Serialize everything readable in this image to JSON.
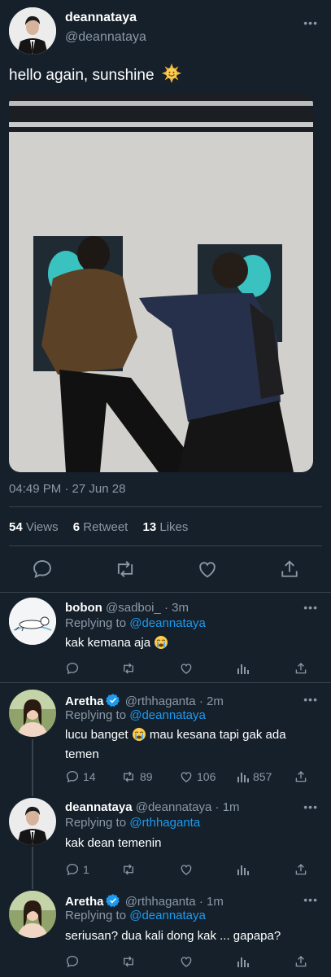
{
  "main": {
    "name": "deannataya",
    "handle": "@deannataya",
    "text": "hello again, sunshine",
    "timestamp": "04:49 PM · 27 Jun 28",
    "stats": {
      "views_count": "54",
      "views_label": "Views",
      "retweets_count": "6",
      "retweets_label": "Retweet",
      "likes_count": "13",
      "likes_label": "Likes"
    },
    "more": "•••"
  },
  "replies": [
    {
      "name": "bobon",
      "handle": "@sadboi_",
      "time": "· 3m",
      "replying_prefix": "Replying to",
      "replying_to": "@deannataya",
      "text": "kak kemana aja",
      "verified": false,
      "counts": {
        "reply": "",
        "retweet": "",
        "like": "",
        "views": ""
      }
    },
    {
      "name": "Aretha",
      "handle": "@rthhaganta",
      "time": "· 2m",
      "replying_prefix": "Replying to",
      "replying_to": "@deannataya",
      "text_a": "lucu banget",
      "text_b": "mau kesana tapi gak ada",
      "text_c": "temen",
      "verified": true,
      "counts": {
        "reply": "14",
        "retweet": "89",
        "like": "106",
        "views": "857"
      }
    },
    {
      "name": "deannataya",
      "handle": "@deannataya",
      "time": "· 1m",
      "replying_prefix": "Replying to",
      "replying_to": "@rthhaganta",
      "text": "kak dean temenin",
      "verified": false,
      "counts": {
        "reply": "1",
        "retweet": "",
        "like": "",
        "views": ""
      }
    },
    {
      "name": "Aretha",
      "handle": "@rthhaganta",
      "time": "· 1m",
      "replying_prefix": "Replying to",
      "replying_to": "@deannataya",
      "text": "seriusan? dua kali dong kak ... gapapa?",
      "verified": true,
      "counts": {
        "reply": "",
        "retweet": "",
        "like": "",
        "views": ""
      }
    }
  ],
  "colors": {
    "background": "#15202b",
    "text": "#ffffff",
    "muted": "#8b98a5",
    "link": "#1d9bf0",
    "divider": "#38444d"
  },
  "icons": [
    "more-icon",
    "sun-emoji",
    "reply-icon",
    "retweet-icon",
    "like-icon",
    "share-icon",
    "views-icon",
    "verified-icon",
    "crying-emoji"
  ]
}
